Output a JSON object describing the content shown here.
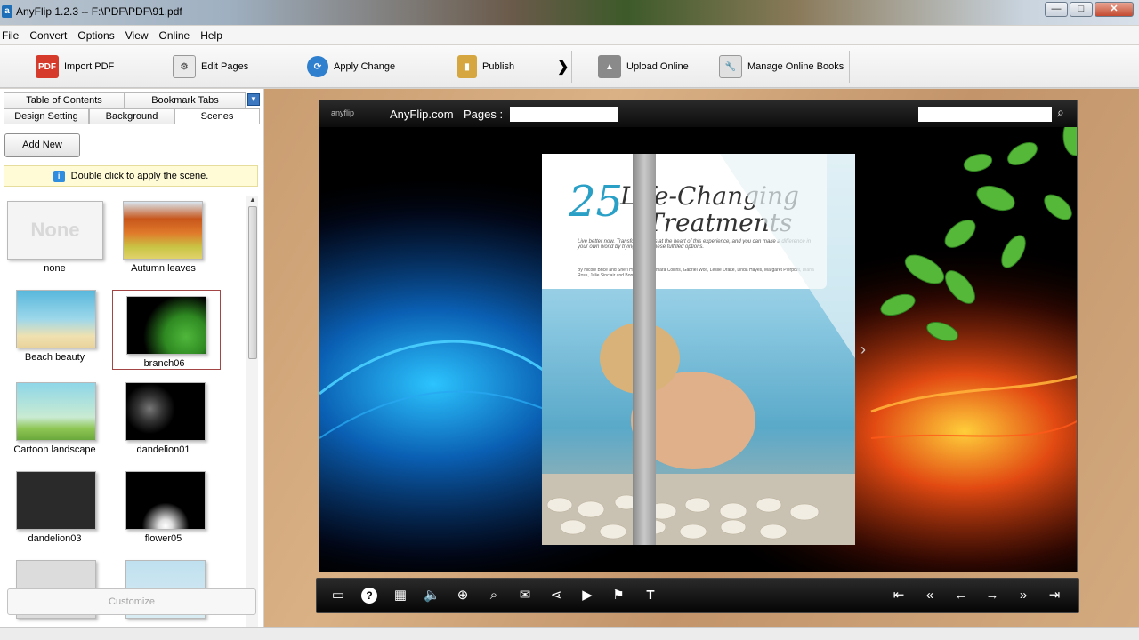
{
  "window": {
    "title": "AnyFlip 1.2.3   -- F:\\PDF\\PDF\\91.pdf",
    "app_icon": "a",
    "controls": {
      "minimize": "—",
      "maximize": "□",
      "close": "✕"
    }
  },
  "menu": [
    "File",
    "Convert",
    "Options",
    "View",
    "Online",
    "Help"
  ],
  "toolbar": {
    "import_pdf": "Import PDF",
    "edit_pages": "Edit Pages",
    "apply_change": "Apply Change",
    "publish": "Publish",
    "more": "❯",
    "upload_online": "Upload Online",
    "manage_online_books": "Manage Online Books"
  },
  "left_panel": {
    "tabs_row1": [
      "Table of Contents",
      "Bookmark Tabs"
    ],
    "tabs_row2": [
      "Design Setting",
      "Background",
      "Scenes"
    ],
    "active_tab": "Scenes",
    "add_new": "Add New",
    "hint": "Double click to apply the scene.",
    "scenes": [
      {
        "label": "none",
        "thumb_text": "None"
      },
      {
        "label": "Autumn leaves"
      },
      {
        "label": "Beach beauty"
      },
      {
        "label": "branch06",
        "selected": true
      },
      {
        "label": "Cartoon landscape"
      },
      {
        "label": "dandelion01"
      },
      {
        "label": "dandelion03"
      },
      {
        "label": "flower05"
      }
    ],
    "customize": "Customize"
  },
  "preview": {
    "logo": "anyflip",
    "site": "AnyFlip.com",
    "pages_label": "Pages :",
    "page": {
      "title_number": "25",
      "title_line1": "Life-Changing",
      "title_line2": "Treatments",
      "subtitle": "Live better now. Transformation is at the heart of this experience, and you can make a difference in your own world by trying any of these fulfilled options.",
      "credits": "By Nicole Brice and Sheri Hyatt, with Tamara Collins, Gabriel Wolf, Leslie Drake, Linda Hayes, Margaret Pierpont, Diana Ross, Julie Sinclair and Bonnie Sisley"
    }
  },
  "book_toolbar_icons": [
    "screen-icon",
    "help-icon",
    "thumbnails-icon",
    "sound-icon",
    "zoom-in-icon",
    "search-icon",
    "email-icon",
    "share-icon",
    "autoplay-icon",
    "bookmark-icon",
    "text-icon",
    "first-page-icon",
    "prev-page-icon",
    "back-icon",
    "forward-icon",
    "next-page-icon",
    "last-page-icon"
  ]
}
